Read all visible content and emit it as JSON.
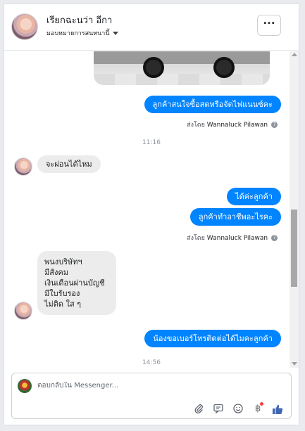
{
  "header": {
    "page_name": "เรียกฉะนว่า อีกา",
    "assign_label": "มอบหมายการสนทนานี้",
    "more_label": "···"
  },
  "thread": {
    "msg_buy": "ลูกค้าสนใจซื้อสดหรือจัดไฟแนนซ์คะ",
    "sent_by_1_prefix": "ส่งโดย",
    "sent_by_1_name": "Wannaluck Pilawan",
    "time_1": "11:16",
    "msg_installment": "จะผ่อนได้ไหม",
    "msg_yes": "ได้ค่ะลูกค้า",
    "msg_job": "ลูกค้าทำอาชีพอะไรคะ",
    "sent_by_2_prefix": "ส่งโดย",
    "sent_by_2_name": "Wannaluck Pilawan",
    "reply_lines": [
      "พนงบริษัทฯ",
      "มีสังคม",
      "เงินเดือนผ่านบัญชี",
      "มีใบรับรอง",
      "ไม่ติด ใส ๆ"
    ],
    "msg_phone": "น้องขอเบอร์โทรติดต่อได้ไมคะลูกค้า",
    "time_2": "14:56"
  },
  "composer": {
    "placeholder": "ตอบกลับใน Messenger..."
  },
  "icons": {
    "info": "?",
    "attach": "paperclip-icon",
    "chat": "chat-bubble-icon",
    "emoji": "smiley-icon",
    "baht": "฿",
    "like": "thumbs-up-icon"
  },
  "colors": {
    "outgoing_bubble": "#0084ff",
    "incoming_bubble": "#ececec",
    "like_blue": "#4267b2"
  }
}
